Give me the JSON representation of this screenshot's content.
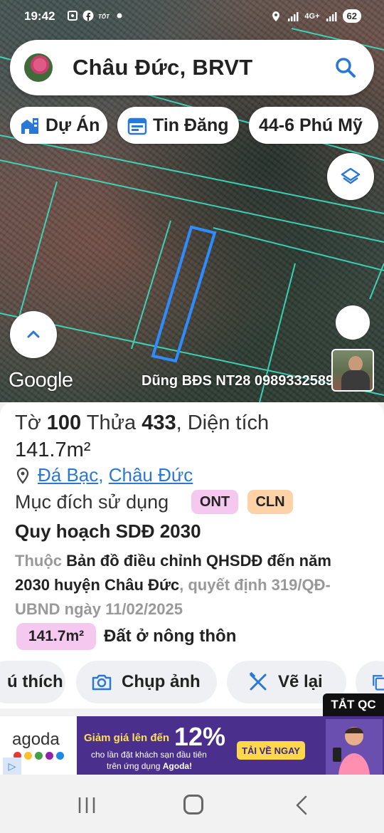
{
  "status_bar": {
    "time": "19:42",
    "network_label": "4G+",
    "battery": "62"
  },
  "search": {
    "location": "Châu Đức, BRVT",
    "icon": "search-icon"
  },
  "chips": {
    "du_an": "Dự Án",
    "tin_dang": "Tin Đăng",
    "place": "44-6 Phú Mỹ"
  },
  "map": {
    "google_label": "Google",
    "watermark": "Dũng BĐS NT28 0989332589",
    "parcel_highlight_color": "#2f8cff",
    "parcel_line_color": "#3de0c0"
  },
  "parcel": {
    "label_to": "Tờ",
    "to_number": "100",
    "label_thua": "Thửa",
    "thua_number": "433",
    "label_area": ", Diện tích",
    "area": "141.7m²",
    "ward": "Đá Bạc",
    "separator": ",",
    "district": "Châu Đức",
    "purpose_label": "Mục đích sử dụng",
    "purpose_codes": [
      "ONT",
      "CLN"
    ],
    "plan_title": "Quy hoạch SDĐ 2030",
    "plan_prefix": "Thuộc",
    "plan_name": "Bản đồ điều chỉnh QHSDĐ đến năm 2030 huyện Châu Đức",
    "plan_suffix": ", quyết định 319/QĐ-UBND ngày 11/02/2025",
    "area_pill": "141.7m²",
    "area_type": "Đất ở nông thôn"
  },
  "actions": {
    "ghi_chu": "ú thích",
    "chup_anh": "Chụp ảnh",
    "ve_lai": "Vẽ lại"
  },
  "ad": {
    "close_label": "TẮT QC",
    "brand": "agoda",
    "headline": "Giảm giá lên đến",
    "percent": "12%",
    "sub1": "cho lần đặt khách sạn đầu tiên",
    "sub2_prefix": "trên ứng dụng",
    "sub2_brand": "Agoda!",
    "cta": "TẢI VỀ NGAY",
    "dot_colors": [
      "#e53935",
      "#fbc02d",
      "#43a047",
      "#8e24aa",
      "#1e88e5"
    ]
  }
}
